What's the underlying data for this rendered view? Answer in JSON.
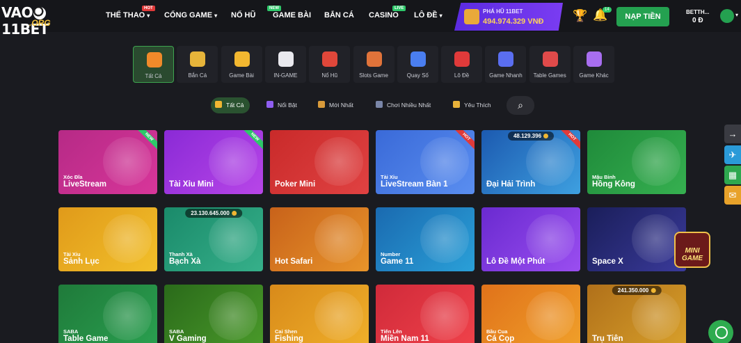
{
  "header": {
    "logo_main": "VAO",
    "logo_bet": "11BET",
    "logo_sub": ".ORG",
    "nav": [
      {
        "label": "THỂ THAO",
        "caret": "▾",
        "badge": "HOT",
        "badge_color": "#e03a3a"
      },
      {
        "label": "CỔNG GAME",
        "caret": "▾",
        "badge": "",
        "badge_color": ""
      },
      {
        "label": "NỔ HŨ",
        "caret": "",
        "badge": "NEW",
        "badge_color": "#2ec86a"
      },
      {
        "label": "GAME BÀI",
        "caret": "",
        "badge": "",
        "badge_color": ""
      },
      {
        "label": "BẮN CÁ",
        "caret": "",
        "badge": "",
        "badge_color": ""
      },
      {
        "label": "CASINO",
        "caret": "",
        "badge": "LIVE",
        "badge_color": "#2ec86a"
      },
      {
        "label": "LÔ ĐỀ",
        "caret": "▾",
        "badge": "",
        "badge_color": ""
      }
    ],
    "jackpot": {
      "label": "PHÁ HŨ 11BET",
      "value": "494.974.329 VNĐ"
    },
    "bell_count": "14",
    "deposit_label": "NẠP TIỀN",
    "user_name": "BETTH...",
    "user_balance": "0 Đ"
  },
  "categories": [
    {
      "label": "Tất Cả",
      "icon": "grid-icon",
      "color": "#f08a2a",
      "active": true
    },
    {
      "label": "Bắn Cá",
      "icon": "fish-icon",
      "color": "#e6b43a",
      "active": false
    },
    {
      "label": "Game Bài",
      "icon": "cards-icon",
      "color": "#f2b730",
      "active": false
    },
    {
      "label": "IN-GAME",
      "icon": "dice-icon",
      "color": "#e9e9ee",
      "active": false
    },
    {
      "label": "Nổ Hũ",
      "icon": "jar-icon",
      "color": "#e0473a",
      "active": false
    },
    {
      "label": "Slots Game",
      "icon": "slot-icon",
      "color": "#e0733a",
      "active": false
    },
    {
      "label": "Quay Số",
      "icon": "balls-icon",
      "color": "#4a7ef0",
      "active": false
    },
    {
      "label": "Lô Đề",
      "icon": "lottery-ball-icon",
      "color": "#e03a3a",
      "active": false
    },
    {
      "label": "Game Nhanh",
      "icon": "rocket-icon",
      "color": "#5a6ef0",
      "active": false
    },
    {
      "label": "Table Games",
      "icon": "chips-icon",
      "color": "#e04a4a",
      "active": false
    },
    {
      "label": "Game Khác",
      "icon": "controller-icon",
      "color": "#a86ef0",
      "active": false
    }
  ],
  "filters": [
    {
      "label": "Tất Cả",
      "icon": "grid-icon",
      "color": "#f0b632",
      "active": true
    },
    {
      "label": "Nổi Bật",
      "icon": "flame-icon",
      "color": "#8f5ef0",
      "active": false
    },
    {
      "label": "Mới Nhất",
      "icon": "sun-icon",
      "color": "#d89a3a",
      "active": false
    },
    {
      "label": "Chơi Nhiều Nhất",
      "icon": "gamepad-icon",
      "color": "#7a86a8",
      "active": false
    },
    {
      "label": "Yêu Thích",
      "icon": "star-icon",
      "color": "#e8b23a",
      "active": false
    }
  ],
  "games": [
    {
      "sub": "Xóc Đĩa",
      "title": "LiveStream",
      "bg": "linear-gradient(135deg,#b62a86,#d8369a)",
      "ribbon": "NEW",
      "ribbon_color": "#2ec86a",
      "jackpot": ""
    },
    {
      "sub": "",
      "title": "Tài Xỉu Mini",
      "bg": "linear-gradient(135deg,#8a2ad6,#b846e8)",
      "ribbon": "NEW",
      "ribbon_color": "#2ec86a",
      "jackpot": ""
    },
    {
      "sub": "",
      "title": "Poker Mini",
      "bg": "linear-gradient(135deg,#c92a2a,#e04242)",
      "ribbon": "",
      "ribbon_color": "",
      "jackpot": ""
    },
    {
      "sub": "Tài Xỉu",
      "title": "LiveStream Bàn 1",
      "bg": "linear-gradient(135deg,#3a6ad8,#5a8ef0)",
      "ribbon": "HOT",
      "ribbon_color": "#e03a3a",
      "jackpot": ""
    },
    {
      "sub": "",
      "title": "Đại Hải Trình",
      "bg": "linear-gradient(135deg,#1c5ab0,#3ea0e0)",
      "ribbon": "HOT",
      "ribbon_color": "#e03a3a",
      "jackpot": "48.129.396"
    },
    {
      "sub": "Mậu Binh",
      "title": "Hồng Kông",
      "bg": "linear-gradient(135deg,#1f8a3a,#36b050)",
      "ribbon": "",
      "ribbon_color": "",
      "jackpot": ""
    },
    {
      "sub": "Tài Xỉu",
      "title": "Sảnh Lục",
      "bg": "linear-gradient(135deg,#e09a1a,#f2c02a)",
      "ribbon": "",
      "ribbon_color": "",
      "jackpot": ""
    },
    {
      "sub": "Thanh Xà",
      "title": "Bạch Xà",
      "bg": "linear-gradient(135deg,#1a8a6a,#36b08a)",
      "ribbon": "",
      "ribbon_color": "",
      "jackpot": "23.130.645.000"
    },
    {
      "sub": "",
      "title": "Hot Safari",
      "bg": "linear-gradient(135deg,#c8621a,#e8942a)",
      "ribbon": "",
      "ribbon_color": "",
      "jackpot": ""
    },
    {
      "sub": "Number",
      "title": "Game 11",
      "bg": "linear-gradient(135deg,#1a6ab0,#2aa0d8)",
      "ribbon": "",
      "ribbon_color": "",
      "jackpot": ""
    },
    {
      "sub": "",
      "title": "Lô Đề Một Phút",
      "bg": "linear-gradient(135deg,#6a2ad0,#9a4ef0)",
      "ribbon": "",
      "ribbon_color": "",
      "jackpot": ""
    },
    {
      "sub": "",
      "title": "Space X",
      "bg": "linear-gradient(135deg,#1a1e5a,#3a3a9a)",
      "ribbon": "",
      "ribbon_color": "",
      "jackpot": ""
    },
    {
      "sub": "SABA",
      "title": "Table Game",
      "bg": "linear-gradient(135deg,#1f7a3a,#2aa050)",
      "ribbon": "",
      "ribbon_color": "",
      "jackpot": ""
    },
    {
      "sub": "SABA",
      "title": "V Gaming",
      "bg": "linear-gradient(135deg,#2a6a1a,#4a9a2a)",
      "ribbon": "",
      "ribbon_color": "",
      "jackpot": ""
    },
    {
      "sub": "Cai Shen",
      "title": "Fishing",
      "bg": "linear-gradient(135deg,#d88a1a,#f0b02a)",
      "ribbon": "",
      "ribbon_color": "",
      "jackpot": ""
    },
    {
      "sub": "Tiến Lên",
      "title": "Miền Nam 11",
      "bg": "linear-gradient(135deg,#d02a3a,#f0424a)",
      "ribbon": "",
      "ribbon_color": "",
      "jackpot": ""
    },
    {
      "sub": "Bầu Cua",
      "title": "Cá Cọp",
      "bg": "linear-gradient(135deg,#e0721a,#f0a02a)",
      "ribbon": "",
      "ribbon_color": "",
      "jackpot": ""
    },
    {
      "sub": "",
      "title": "Trụ Tiên",
      "bg": "linear-gradient(135deg,#b0701a,#d8a02a)",
      "ribbon": "",
      "ribbon_color": "",
      "jackpot": "241.350.000"
    }
  ],
  "mini_game_label": "MINI GAME",
  "side_buttons": [
    {
      "icon": "arrow-right-icon",
      "glyph": "→",
      "color": "#3a3b42"
    },
    {
      "icon": "telegram-icon",
      "glyph": "✈",
      "color": "#2a9ad8"
    },
    {
      "icon": "ticket-icon",
      "glyph": "▦",
      "color": "#2ea84f"
    },
    {
      "icon": "mail-icon",
      "glyph": "✉",
      "color": "#e8a22a"
    }
  ]
}
